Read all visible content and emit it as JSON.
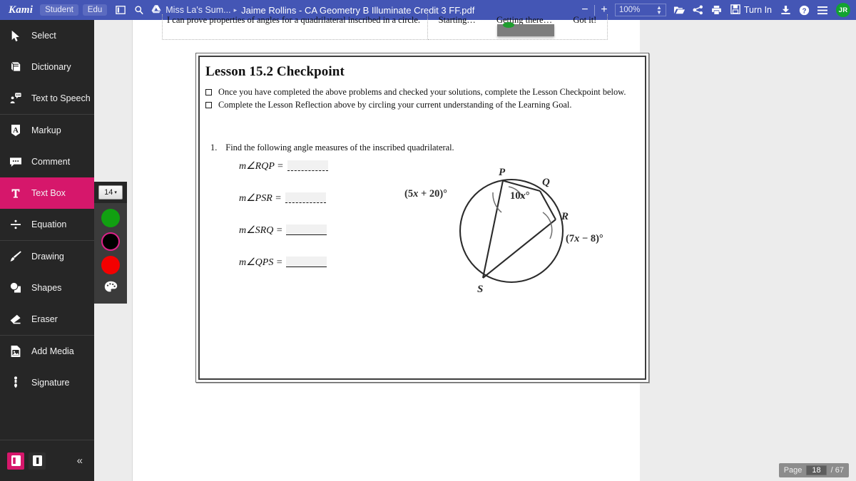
{
  "topbar": {
    "logo": "Kami",
    "badge_student": "Student",
    "badge_edu": "Edu",
    "panel_icon": "panel-toggle-icon",
    "search_icon": "search-icon",
    "drive_icon": "google-drive-icon",
    "folder_name": "Miss La's Sum...",
    "chevron": "▸",
    "doc_title": "Jaime Rollins - CA Geometry B Illuminate Credit 3 FF.pdf",
    "zoom_out": "−",
    "zoom_in": "+",
    "zoom_value": "100%",
    "open_icon": "open-folder-icon",
    "share_icon": "share-icon",
    "print_icon": "print-icon",
    "save_icon": "floppy-save-icon",
    "turn_in_label": "Turn In",
    "download_icon": "download-icon",
    "help_icon": "help-circle-icon",
    "menu_icon": "hamburger-menu-icon",
    "avatar_initials": "JR",
    "colors": {
      "bar": "#4456b5",
      "avatar": "#12a330"
    }
  },
  "sidebar": {
    "tools": [
      {
        "label": "Select",
        "icon": "cursor-arrow-icon",
        "active": false
      },
      {
        "label": "Dictionary",
        "icon": "book-icon",
        "active": false
      },
      {
        "label": "Text to Speech",
        "icon": "speech-person-icon",
        "active": false
      },
      {
        "label": "Markup",
        "icon": "highlighter-a-icon",
        "active": false
      },
      {
        "label": "Comment",
        "icon": "comment-bubble-icon",
        "active": false
      },
      {
        "label": "Text Box",
        "icon": "text-t-icon",
        "active": true
      },
      {
        "label": "Equation",
        "icon": "divide-icon",
        "active": false
      },
      {
        "label": "Drawing",
        "icon": "paintbrush-icon",
        "active": false
      },
      {
        "label": "Shapes",
        "icon": "shapes-icon",
        "active": false
      },
      {
        "label": "Eraser",
        "icon": "eraser-icon",
        "active": false
      },
      {
        "label": "Add Media",
        "icon": "image-file-icon",
        "active": false
      },
      {
        "label": "Signature",
        "icon": "signature-pen-icon",
        "active": false
      }
    ],
    "active_color": "#d6176b",
    "panel_toggle_left": "split-view-left-icon",
    "panel_toggle_right": "split-view-right-icon",
    "collapse_icon": "double-chevron-left-icon"
  },
  "tool_options": {
    "font_size": "14",
    "caret": "▾",
    "swatches": [
      {
        "name": "green-swatch",
        "color": "#11a011",
        "selected": false
      },
      {
        "name": "black-swatch",
        "color": "#000000",
        "selected": true
      },
      {
        "name": "red-swatch",
        "color": "#f40000",
        "selected": false
      }
    ],
    "palette_icon": "color-palette-icon",
    "selection_ring": "#e0218a"
  },
  "document": {
    "top_row": {
      "goal_text": "I can prove properties of angles for a quadrilateral inscribed in a circle.",
      "scale": [
        "Starting…",
        "Getting there…",
        "Got it!"
      ],
      "overlay": "masked-annotation-overlay"
    },
    "checkpoint": {
      "title": "Lesson 15.2 Checkpoint",
      "bullets": [
        "Once you have completed the above problems and checked your solutions, complete the Lesson Checkpoint below.",
        "Complete the Lesson Reflection above by circling your current understanding of the Learning Goal."
      ],
      "question_number": "1.",
      "question_text": "Find the following angle measures of the inscribed quadrilateral.",
      "answers": [
        {
          "label": "m∠RQP =",
          "value": ""
        },
        {
          "label": "m∠PSR =",
          "value": ""
        },
        {
          "label": "m∠SRQ =",
          "value": ""
        },
        {
          "label": "m∠QPS =",
          "value": ""
        }
      ],
      "figure": {
        "name": "inscribed-quadrilateral-circle-diagram",
        "vertex_labels": [
          "P",
          "Q",
          "R",
          "S"
        ],
        "angle_labels": [
          "(5x + 20)°",
          "10x°",
          "(7x − 8)°"
        ]
      }
    }
  },
  "page_indicator": {
    "label": "Page",
    "current": "18",
    "total": "/ 67"
  }
}
